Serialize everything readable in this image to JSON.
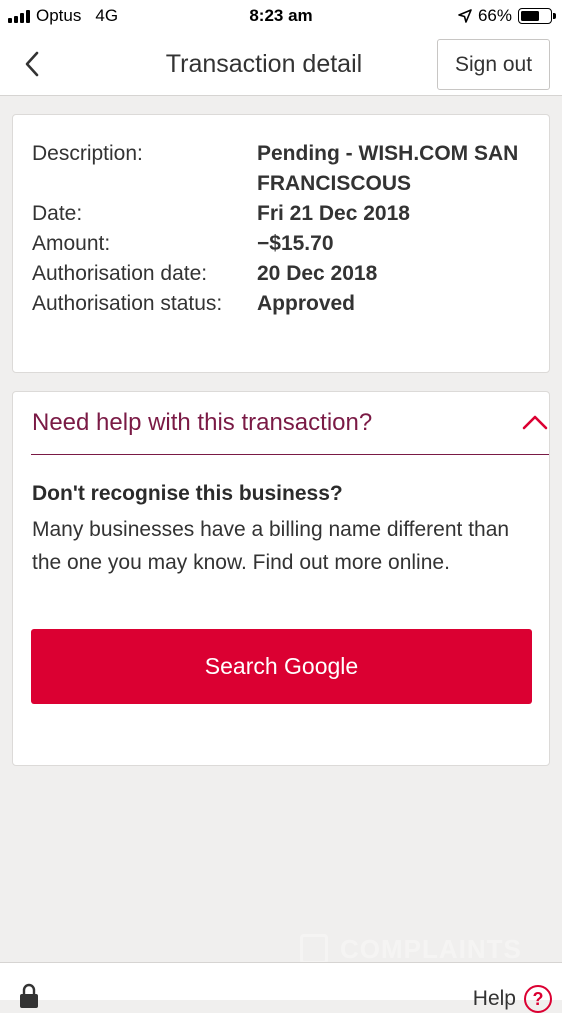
{
  "status_bar": {
    "carrier": "Optus",
    "network": "4G",
    "time": "8:23 am",
    "battery": "66%",
    "battery_level": 0.66
  },
  "nav": {
    "title": "Transaction detail",
    "sign_out": "Sign out"
  },
  "details": {
    "description_label": "Description:",
    "description_value": "Pending - WISH.COM SAN FRANCISCOUS",
    "date_label": "Date:",
    "date_value": "Fri 21 Dec 2018",
    "amount_label": "Amount:",
    "amount_value": "−$15.70",
    "auth_date_label": "Authorisation date:",
    "auth_date_value": "20 Dec 2018",
    "auth_status_label": "Authorisation status:",
    "auth_status_value": "Approved"
  },
  "help": {
    "title": "Need help with this transaction?",
    "question": "Don't recognise this business?",
    "text": "Many businesses have a billing name different than the one you may know. Find out more online.",
    "button": "Search Google"
  },
  "watermark": "COMPLAINTS",
  "bottom": {
    "help_label": "Help",
    "help_symbol": "?"
  },
  "colors": {
    "brand_red": "#db0032",
    "brand_maroon": "#7a1a45",
    "background": "#f0efee"
  },
  "icons": [
    "signal-icon",
    "location-arrow-icon",
    "battery-icon",
    "back-chevron-icon",
    "chevron-up-icon",
    "lock-icon",
    "help-circle-icon"
  ]
}
